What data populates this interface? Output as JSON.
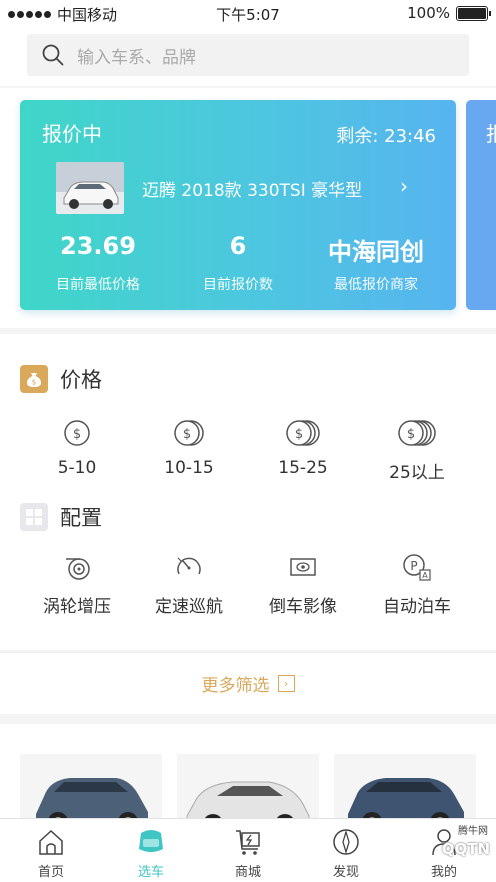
{
  "status_bar": {
    "carrier": "中国移动",
    "time": "下午5:07",
    "battery": "100%"
  },
  "search": {
    "placeholder": "输入车系、品牌"
  },
  "quote_card": {
    "status": "报价中",
    "remaining": "剩余: 23:46",
    "car_name": "迈腾 2018款 330TSI 豪华型",
    "stats": [
      {
        "value": "23.69",
        "label": "目前最低价格"
      },
      {
        "value": "6",
        "label": "目前报价数"
      },
      {
        "value": "中海同创",
        "label": "最低报价商家"
      }
    ],
    "next_card_initial": "报"
  },
  "price_section": {
    "title": "价格",
    "options": [
      {
        "label": "5-10",
        "icon": "coin-single-icon"
      },
      {
        "label": "10-15",
        "icon": "coin-double-icon"
      },
      {
        "label": "15-25",
        "icon": "coin-triple-icon"
      },
      {
        "label": "25以上",
        "icon": "coin-quad-icon"
      }
    ]
  },
  "config_section": {
    "title": "配置",
    "options": [
      {
        "label": "涡轮增压",
        "icon": "turbo-icon"
      },
      {
        "label": "定速巡航",
        "icon": "speedometer-icon"
      },
      {
        "label": "倒车影像",
        "icon": "camera-icon"
      },
      {
        "label": "自动泊车",
        "icon": "parking-icon"
      }
    ]
  },
  "more_filters": {
    "label": "更多筛选"
  },
  "tab_bar": {
    "tabs": [
      {
        "label": "首页",
        "icon": "home-icon"
      },
      {
        "label": "选车",
        "icon": "car-seat-icon",
        "active": true
      },
      {
        "label": "商城",
        "icon": "cart-icon"
      },
      {
        "label": "发现",
        "icon": "compass-icon"
      },
      {
        "label": "我的",
        "icon": "user-icon"
      }
    ]
  },
  "watermark": {
    "text": "QQTN",
    "small": "腾牛网"
  },
  "colors": {
    "accent": "#3fc6c4",
    "gold": "#d9a85b",
    "card_start": "#3fd6c8",
    "card_end": "#57b4ef"
  }
}
